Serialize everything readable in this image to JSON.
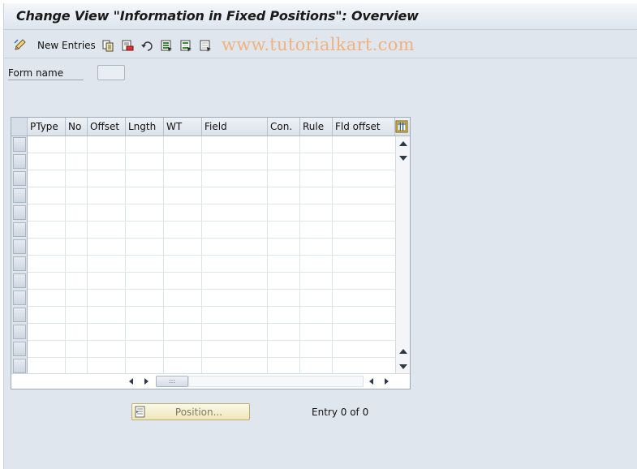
{
  "window": {
    "title": "Change View \"Information in Fixed Positions\": Overview"
  },
  "toolbar": {
    "new_entries_label": "New Entries",
    "icons": [
      "edit-pencil-icon",
      "copy-icon",
      "delete-icon",
      "undo-icon",
      "select-all-icon",
      "select-block-icon",
      "deselect-all-icon"
    ]
  },
  "watermark": "www.tutorialkart.com",
  "form": {
    "form_name_label": "Form name",
    "form_name_value": ""
  },
  "table": {
    "columns": [
      "PType",
      "No",
      "Offset",
      "Lngth",
      "WT",
      "Field",
      "Con.",
      "Rule",
      "Fld offset"
    ],
    "row_count": 14,
    "rows": []
  },
  "position_button": {
    "label": "Position..."
  },
  "entry_info": "Entry 0 of 0",
  "colors": {
    "frame_bg": "#dfe6ee",
    "watermark": "#f0b27f",
    "position_button_bg": "#efe7b8"
  }
}
